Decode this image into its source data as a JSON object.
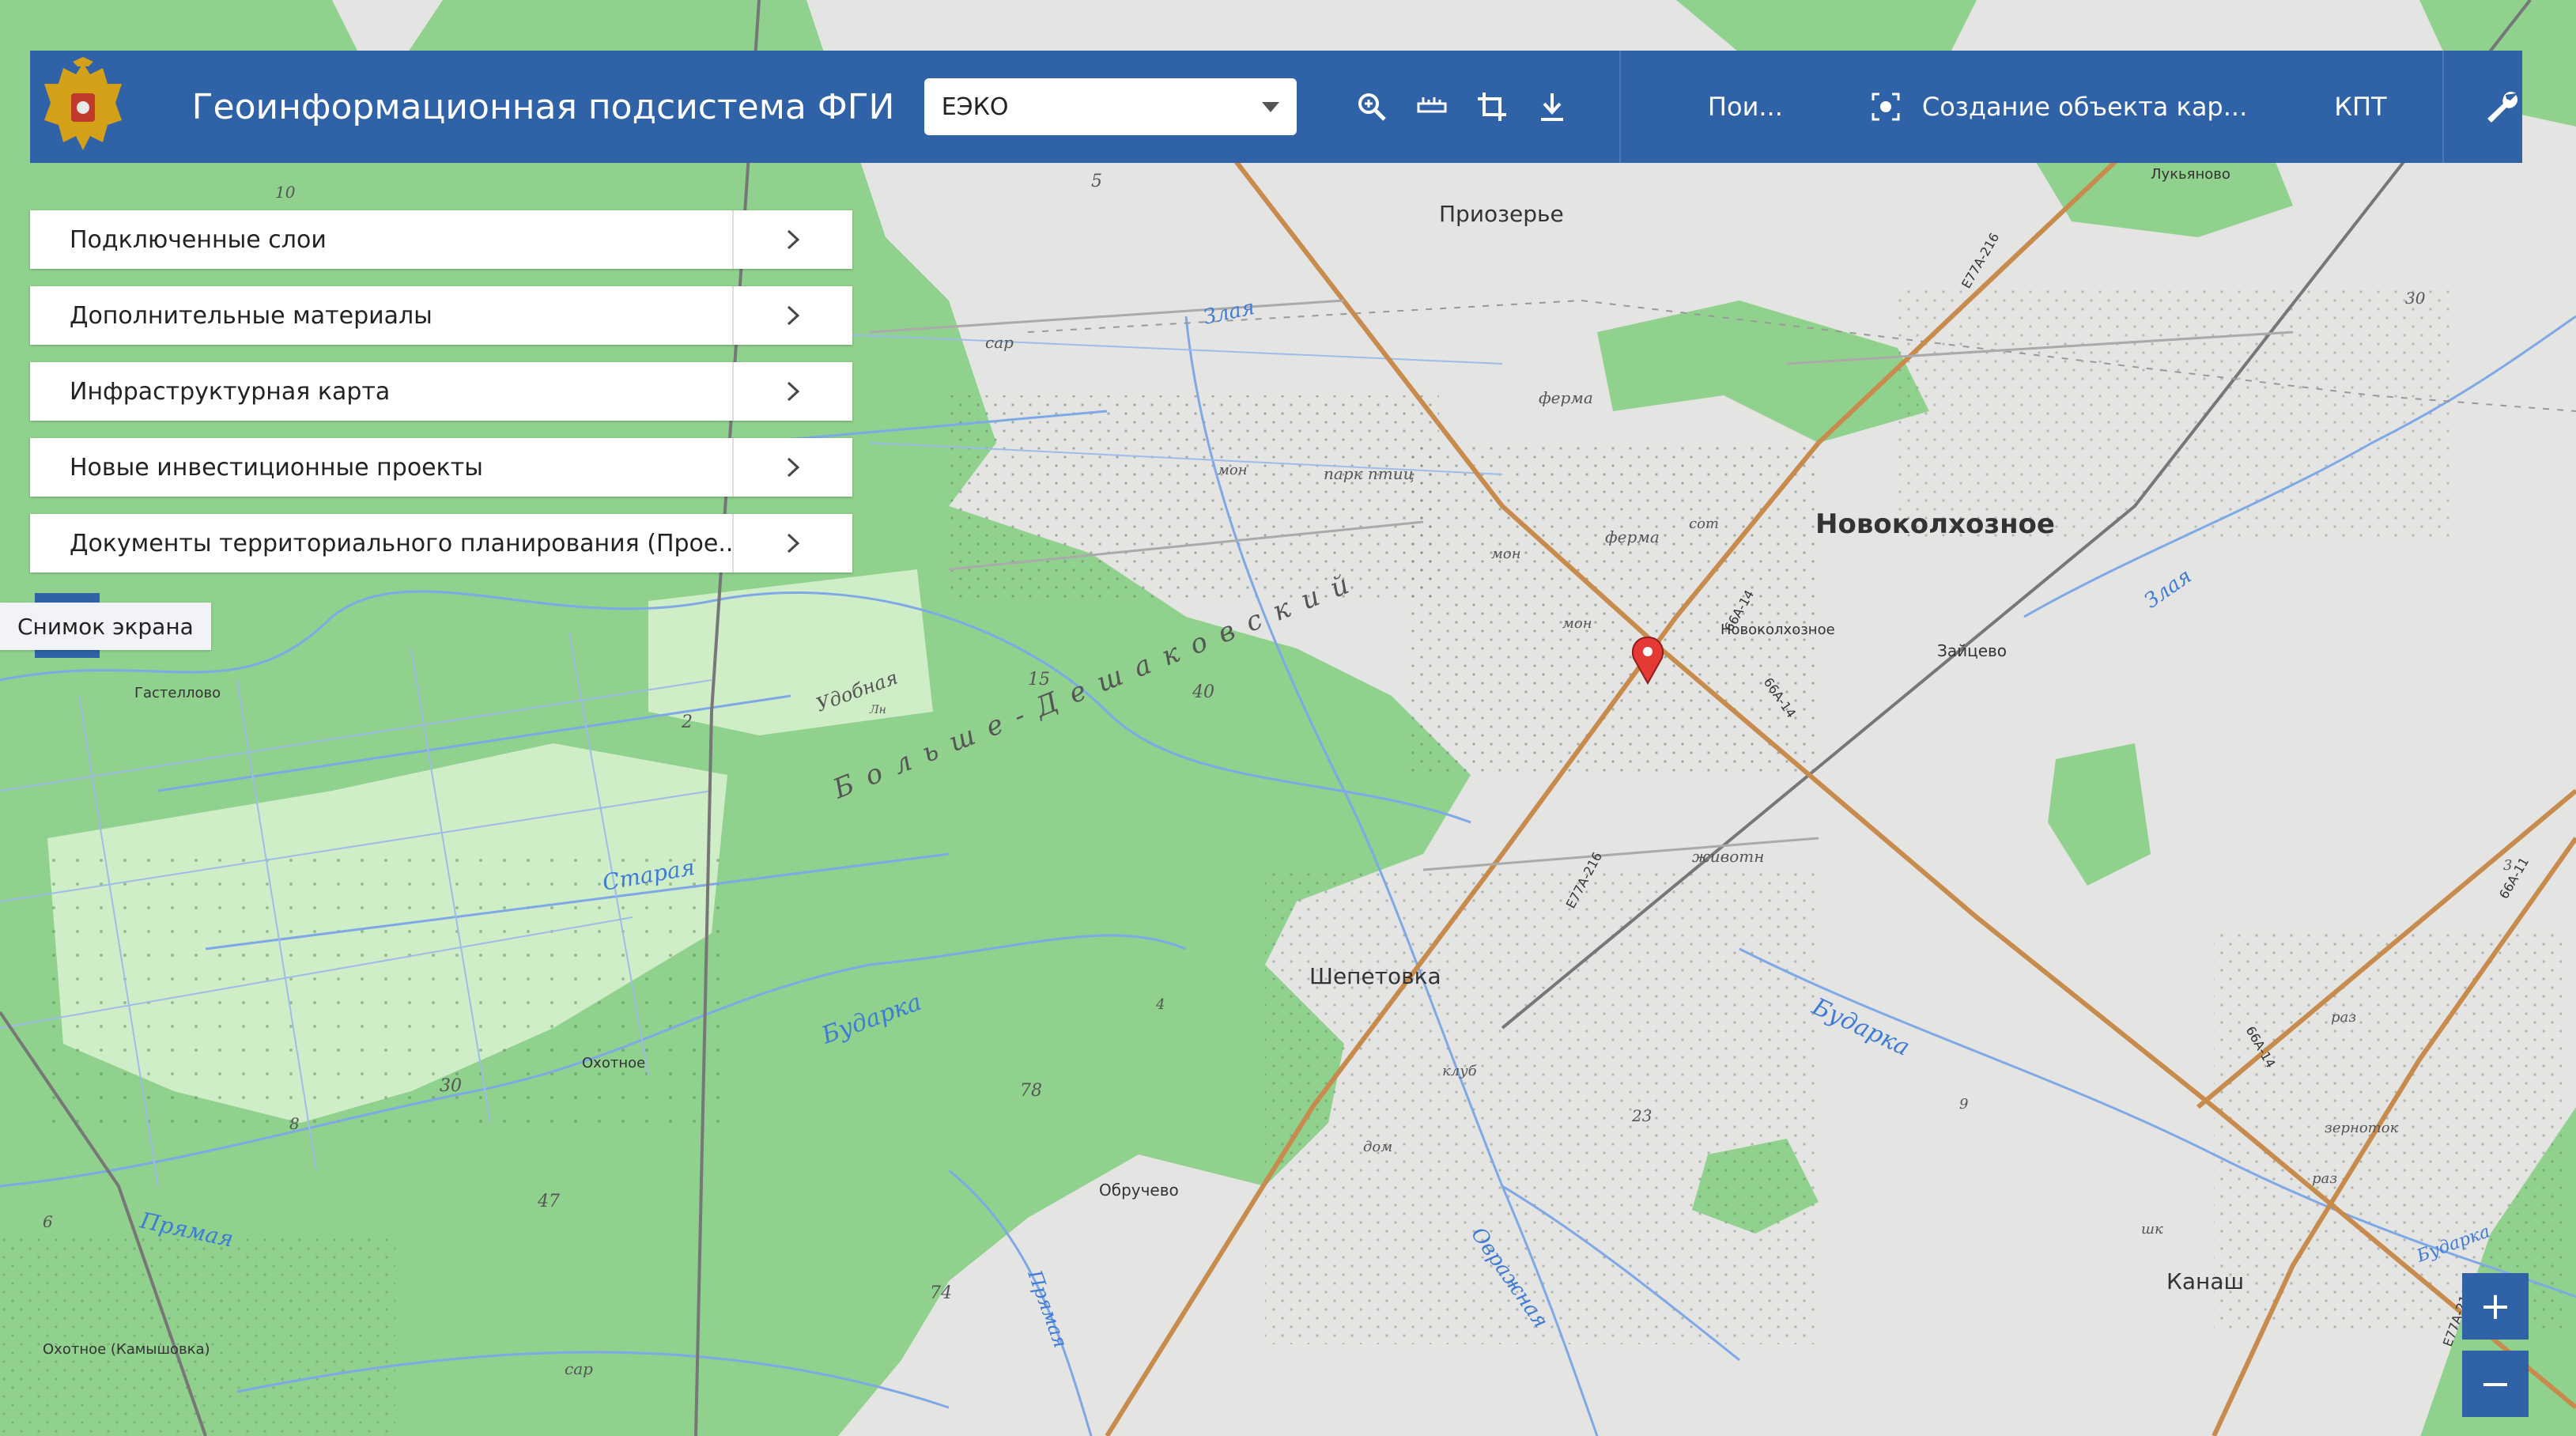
{
  "header": {
    "title": "Геоинформационная подсистема ФГИС ТП",
    "layer_select_value": "ЕЭКО",
    "search_label": "Пои...",
    "create_object_label": "Создание объекта кар...",
    "kpt_label": "КПТ"
  },
  "icons": {
    "zoom": "magnify-icon",
    "ruler": "ruler-icon",
    "crop": "crop-icon",
    "download": "download-icon",
    "screenshot": "focus-icon",
    "settings": "wrench-icon",
    "emblem": "coat-of-arms"
  },
  "panel": {
    "items": [
      {
        "label": "Подключенные слои"
      },
      {
        "label": "Дополнительные материалы"
      },
      {
        "label": "Инфраструктурная карта"
      },
      {
        "label": "Новые инвестиционные проекты"
      },
      {
        "label": "Документы территориального планирования (Прое..."
      }
    ]
  },
  "tooltip": {
    "label": "Снимок экрана"
  },
  "zoom": {
    "in_label": "+",
    "out_label": "−"
  },
  "colors": {
    "header": "#2f62a6",
    "forest": "#8fd18d",
    "open_land": "#e4e4e2",
    "road": "#c88b4e",
    "river": "#7fa8e6",
    "marker": "#e53935"
  },
  "map": {
    "settlements": [
      "Приозерье",
      "Новоколхозное",
      "Шепетовка",
      "Канаш",
      "Лукьяново",
      "Зайцево",
      "Гастеллово",
      "Охотное",
      "Обручево",
      "Охотное (Камышовка)",
      "Новоколхозное"
    ],
    "rivers": [
      "Злая",
      "Бударка",
      "Старая",
      "Прямая",
      "Овражная",
      "Бударка",
      "Злая",
      "Прямая",
      "Бударка"
    ],
    "forest_names": [
      "Больше-Дешаковский",
      "Удобная"
    ],
    "features": [
      "ферма",
      "ферма",
      "мон",
      "парк птиц",
      "сот",
      "жи­вотн",
      "клуб",
      "дом",
      "зерноток",
      "раз",
      "шк",
      "сар",
      "сар",
      "мон",
      "мон",
      "раз"
    ],
    "roads": [
      "Е77А-216",
      "66А-14",
      "66А-14",
      "66А-14",
      "Е77А-216",
      "Е77А-216",
      "66А-11"
    ],
    "numbers": [
      "5",
      "10",
      "2",
      "15",
      "40",
      "30",
      "30",
      "47",
      "78",
      "74",
      "6",
      "8",
      "23",
      "4",
      "3",
      "9",
      "Лн"
    ]
  }
}
